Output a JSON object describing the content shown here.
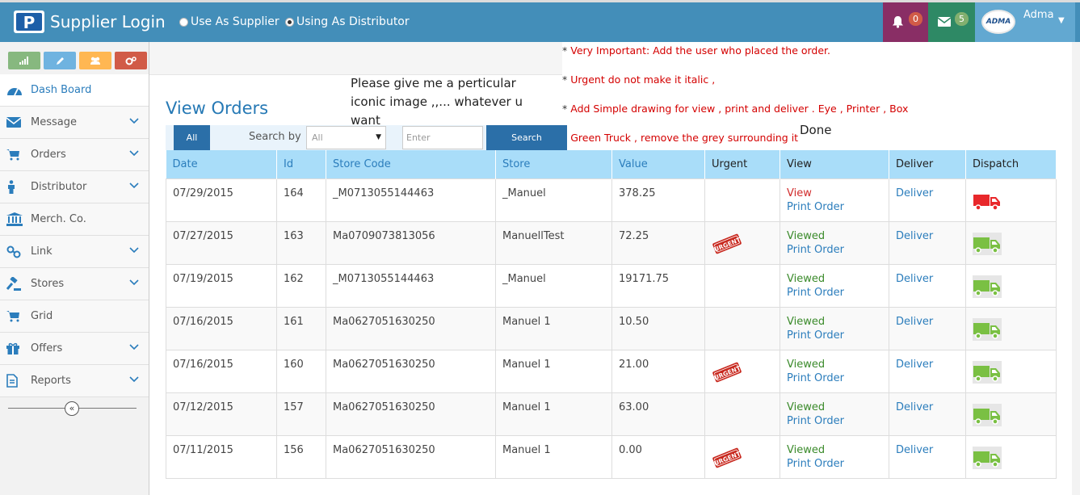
{
  "header": {
    "logo_letter": "P",
    "title": "Supplier Login",
    "roles": [
      {
        "label": "Use As Supplier",
        "selected": false
      },
      {
        "label": "Using As Distributor",
        "selected": true
      }
    ],
    "notifications_count": "0",
    "messages_count": "5",
    "avatar_text": "ADMA",
    "user_name": "Adma"
  },
  "sidebar": {
    "items": [
      {
        "label": "Dash Board",
        "icon": "dashboard-icon",
        "has_submenu": false
      },
      {
        "label": "Message",
        "icon": "envelope-icon",
        "has_submenu": true
      },
      {
        "label": "Orders",
        "icon": "cart-icon",
        "has_submenu": true
      },
      {
        "label": "Distributor",
        "icon": "person-icon",
        "has_submenu": true
      },
      {
        "label": "Merch. Co.",
        "icon": "bank-icon",
        "has_submenu": false
      },
      {
        "label": "Link",
        "icon": "link-icon",
        "has_submenu": true
      },
      {
        "label": "Stores",
        "icon": "gavel-icon",
        "has_submenu": true
      },
      {
        "label": "Grid",
        "icon": "cart-icon",
        "has_submenu": false
      },
      {
        "label": "Offers",
        "icon": "gift-icon",
        "has_submenu": true
      },
      {
        "label": "Reports",
        "icon": "file-icon",
        "has_submenu": true
      }
    ],
    "collapse_glyph": "«"
  },
  "main": {
    "title": "View Orders",
    "filter": {
      "all_label": "All",
      "search_by_label": "Search by",
      "select_value": "All",
      "input_placeholder": "Enter",
      "search_button": "Search"
    },
    "table": {
      "columns": [
        "Date",
        "Id",
        "Store Code",
        "Store",
        "Value",
        "Urgent",
        "View",
        "Deliver",
        "Dispatch"
      ],
      "rows": [
        {
          "date": "07/29/2015",
          "id": "164",
          "store_code": "_M0713055144463",
          "store": "_Manuel",
          "value": "378.25",
          "urgent": false,
          "view": "View",
          "print": "Print Order",
          "deliver": "Deliver",
          "truck_color": "#e8282b"
        },
        {
          "date": "07/27/2015",
          "id": "163",
          "store_code": "Ma0709073813056",
          "store": "ManuellTest",
          "value": "72.25",
          "urgent": true,
          "view": "Viewed",
          "print": "Print Order",
          "deliver": "Deliver",
          "truck_color": "#7ac043"
        },
        {
          "date": "07/19/2015",
          "id": "162",
          "store_code": "_M0713055144463",
          "store": "_Manuel",
          "value": "19171.75",
          "urgent": false,
          "view": "Viewed",
          "print": "Print Order",
          "deliver": "Deliver",
          "truck_color": "#7ac043"
        },
        {
          "date": "07/16/2015",
          "id": "161",
          "store_code": "Ma0627051630250",
          "store": "Manuel 1",
          "value": "10.50",
          "urgent": false,
          "view": "Viewed",
          "print": "Print Order",
          "deliver": "Deliver",
          "truck_color": "#7ac043"
        },
        {
          "date": "07/16/2015",
          "id": "160",
          "store_code": "Ma0627051630250",
          "store": "Manuel 1",
          "value": "21.00",
          "urgent": true,
          "view": "Viewed",
          "print": "Print Order",
          "deliver": "Deliver",
          "truck_color": "#7ac043"
        },
        {
          "date": "07/12/2015",
          "id": "157",
          "store_code": "Ma0627051630250",
          "store": "Manuel 1",
          "value": "63.00",
          "urgent": false,
          "view": "Viewed",
          "print": "Print Order",
          "deliver": "Deliver",
          "truck_color": "#7ac043"
        },
        {
          "date": "07/11/2015",
          "id": "156",
          "store_code": "Ma0627051630250",
          "store": "Manuel 1",
          "value": "0.00",
          "urgent": true,
          "view": "Viewed",
          "print": "Print Order",
          "deliver": "Deliver",
          "truck_color": "#7ac043"
        }
      ],
      "urgent_stamp_text": "URGENT"
    }
  },
  "annotations": {
    "request": "Please give me a perticular iconic image ,,... whatever u want",
    "notes": [
      "Very Important: Add the user who placed the order.",
      "Urgent do not make it italic ,",
      "Add Simple drawing for view , print and deliver . Eye , Printer , Box",
      "Green Truck , remove the grey surrounding it"
    ],
    "done": "Done"
  },
  "colors": {
    "topbar": "#438eb9",
    "notif_bg": "#892e65",
    "msg_bg": "#2e8965",
    "user_bg": "#62a8d1",
    "table_header": "#a9ddf9",
    "button": "#2b6fa8"
  }
}
